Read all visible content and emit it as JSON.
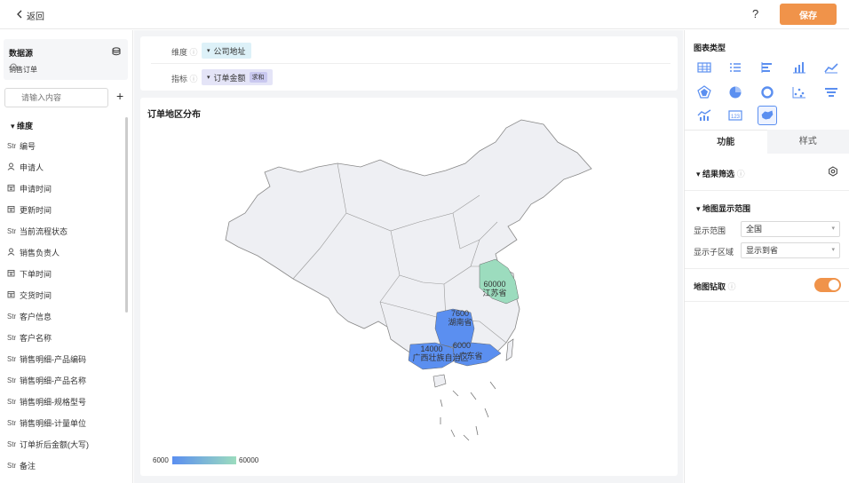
{
  "header": {
    "back_label": "返回",
    "help_label": "?",
    "save_label": "保存"
  },
  "data_source": {
    "title": "数据源",
    "name": "销售订单",
    "search_placeholder": "请输入内容",
    "dim_header": "维度",
    "fields": [
      {
        "type": "Str",
        "icon": "text-type-icon",
        "label": "编号"
      },
      {
        "type": "",
        "icon": "person-icon",
        "label": "申请人"
      },
      {
        "type": "",
        "icon": "calendar-icon",
        "label": "申请时间"
      },
      {
        "type": "",
        "icon": "calendar-icon",
        "label": "更新时间"
      },
      {
        "type": "Str",
        "icon": "text-type-icon",
        "label": "当前流程状态"
      },
      {
        "type": "",
        "icon": "person-icon",
        "label": "销售负责人"
      },
      {
        "type": "",
        "icon": "calendar-icon",
        "label": "下单时间"
      },
      {
        "type": "",
        "icon": "calendar-icon",
        "label": "交货时间"
      },
      {
        "type": "Str",
        "icon": "text-type-icon",
        "label": "客户信息"
      },
      {
        "type": "Str",
        "icon": "text-type-icon",
        "label": "客户名称"
      },
      {
        "type": "Str",
        "icon": "text-type-icon",
        "label": "销售明细-产品编码"
      },
      {
        "type": "Str",
        "icon": "text-type-icon",
        "label": "销售明细-产品名称"
      },
      {
        "type": "Str",
        "icon": "text-type-icon",
        "label": "销售明细-规格型号"
      },
      {
        "type": "Str",
        "icon": "text-type-icon",
        "label": "销售明细-计量单位"
      },
      {
        "type": "Str",
        "icon": "text-type-icon",
        "label": "订单折后金额(大写)"
      },
      {
        "type": "Str",
        "icon": "text-type-icon",
        "label": "备注"
      }
    ]
  },
  "config": {
    "dim_label": "维度",
    "dim_value": "公司地址",
    "mea_label": "指标",
    "mea_value": "订单金额",
    "mea_agg": "求和"
  },
  "chart": {
    "title": "订单地区分布",
    "legend_min": "6000",
    "legend_max": "60000",
    "colors": {
      "low": "#5b8ff0",
      "high": "#9cdcbe",
      "base": "#eeeff3"
    }
  },
  "chart_data": {
    "type": "map",
    "title": "订单地区分布",
    "regions": [
      {
        "name": "江苏省",
        "value": 60000
      },
      {
        "name": "湖南省",
        "value": 7600
      },
      {
        "name": "广西壮族自治区",
        "value": 14000
      },
      {
        "name": "广东省",
        "value": 6000
      }
    ],
    "visual_range": [
      6000,
      60000
    ]
  },
  "right_panel": {
    "chart_type_title": "图表类型",
    "chart_types": [
      "table-icon",
      "list-icon",
      "bar-horizontal-icon",
      "bar-chart-icon",
      "line-chart-icon",
      "radar-icon",
      "pie-chart-icon",
      "donut-icon",
      "scatter-icon",
      "funnel-icon",
      "combo-chart-icon",
      "number-card-icon",
      "map-chart-icon"
    ],
    "tab_function": "功能",
    "tab_style": "样式",
    "filter_title": "结果筛选",
    "map_range_title": "地图显示范围",
    "range_label": "显示范围",
    "range_value": "全国",
    "subarea_label": "显示子区域",
    "subarea_value": "显示到省",
    "drill_label": "地图钻取"
  }
}
